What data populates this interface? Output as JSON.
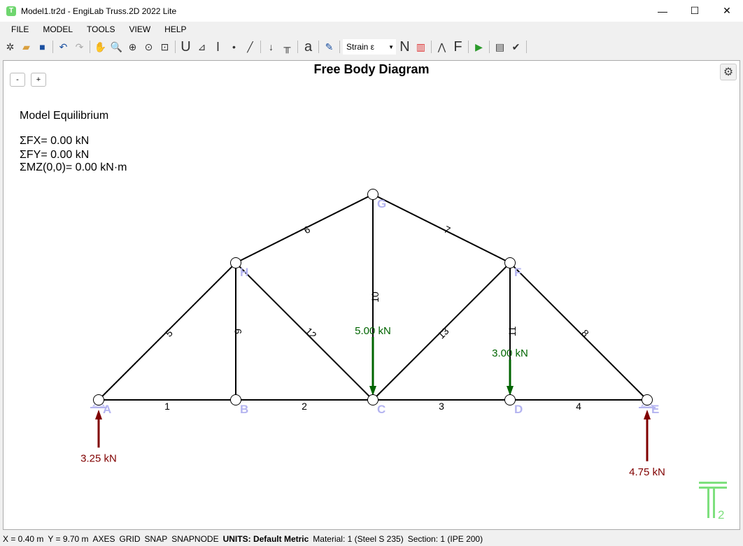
{
  "window": {
    "title": "Model1.tr2d - EngiLab Truss.2D 2022 Lite",
    "app_icon": "T"
  },
  "menu": [
    "FILE",
    "MODEL",
    "TOOLS",
    "VIEW",
    "HELP"
  ],
  "toolbar": {
    "result_select": "Strain ε",
    "n_label": "N",
    "f_label": "F",
    "a_label": "a",
    "u_label": "U"
  },
  "canvas": {
    "title": "Free Body Diagram",
    "zoom_out": "-",
    "zoom_in": "+",
    "equilibrium": {
      "heading": "Model Equilibrium",
      "fx": "ΣFX= 0.00 kN",
      "fy": "ΣFY= 0.00 kN",
      "mz": "ΣMZ(0,0)= 0.00 kN·m"
    },
    "logo": "T2"
  },
  "colors": {
    "node_label": "#b4b4f0",
    "load": "#006400",
    "reaction": "#800000",
    "logo": "#7ee07e"
  },
  "nodes": [
    {
      "id": "A",
      "support": "pin"
    },
    {
      "id": "B"
    },
    {
      "id": "C"
    },
    {
      "id": "D"
    },
    {
      "id": "E",
      "support": "roller"
    },
    {
      "id": "H"
    },
    {
      "id": "G"
    },
    {
      "id": "F"
    }
  ],
  "members": [
    {
      "label": "1",
      "from": "A",
      "to": "B"
    },
    {
      "label": "2",
      "from": "B",
      "to": "C"
    },
    {
      "label": "3",
      "from": "C",
      "to": "D"
    },
    {
      "label": "4",
      "from": "D",
      "to": "E"
    },
    {
      "label": "5",
      "from": "A",
      "to": "H"
    },
    {
      "label": "6",
      "from": "H",
      "to": "G"
    },
    {
      "label": "7",
      "from": "G",
      "to": "F"
    },
    {
      "label": "8",
      "from": "F",
      "to": "E"
    },
    {
      "label": "9",
      "from": "B",
      "to": "H"
    },
    {
      "label": "10",
      "from": "C",
      "to": "G"
    },
    {
      "label": "11",
      "from": "D",
      "to": "F"
    },
    {
      "label": "12",
      "from": "H",
      "to": "C"
    },
    {
      "label": "13",
      "from": "C",
      "to": "F"
    }
  ],
  "loads": [
    {
      "node": "C",
      "label": "5.00 kN",
      "value": 5.0
    },
    {
      "node": "D",
      "label": "3.00 kN",
      "value": 3.0
    }
  ],
  "reactions": [
    {
      "node": "A",
      "label": "3.25 kN",
      "value": 3.25
    },
    {
      "node": "E",
      "label": "4.75 kN",
      "value": 4.75
    }
  ],
  "status": {
    "x": "X = 0.40 m",
    "y": "Y = 9.70 m",
    "axes": "AXES",
    "grid": "GRID",
    "snap": "SNAP",
    "snapnode": "SNAPNODE",
    "units_label": "UNITS:",
    "units": "Default Metric",
    "material": "Material: 1 (Steel S 235)",
    "section": "Section: 1 (IPE 200)"
  }
}
